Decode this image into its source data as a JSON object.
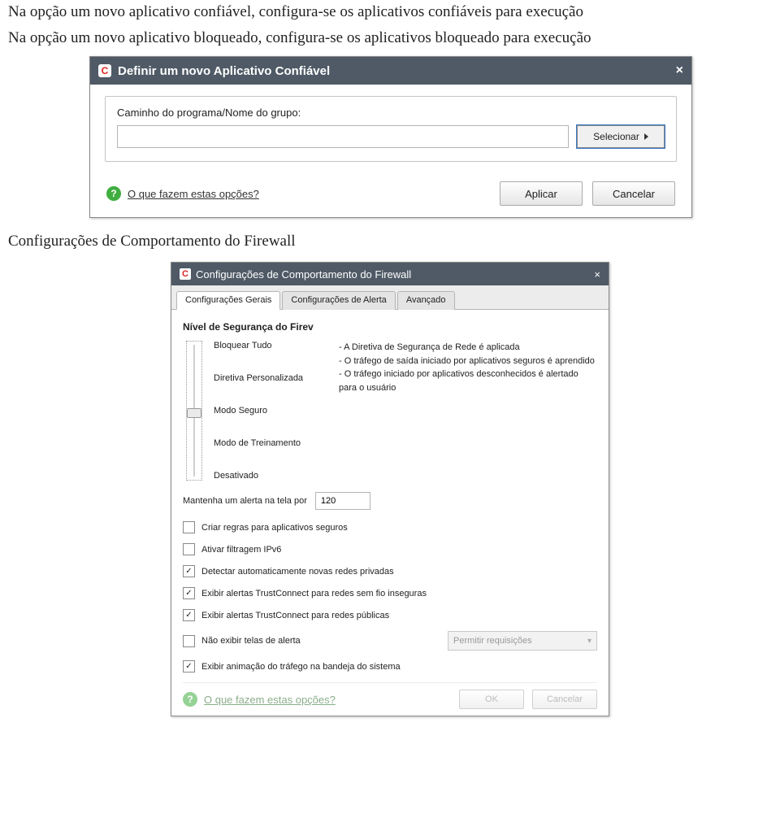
{
  "doc": {
    "line1": "Na opção um novo aplicativo confiável, configura-se os aplicativos confiáveis para execução",
    "line2": "Na opção um novo aplicativo bloqueado, configura-se os aplicativos bloqueado para execução",
    "section2": "Configurações de Comportamento do Firewall"
  },
  "dialog1": {
    "logo_letter": "C",
    "title": "Definir um novo Aplicativo Confiável",
    "close": "×",
    "field_label": "Caminho do programa/Nome do grupo:",
    "input_value": "",
    "select_label": "Selecionar",
    "help_q": "?",
    "help_text": "O que fazem estas opções?",
    "apply": "Aplicar",
    "cancel": "Cancelar"
  },
  "dialog2": {
    "logo_letter": "C",
    "title": "Configurações de Comportamento do Firewall",
    "close": "×",
    "tabs": {
      "t0": "Configurações Gerais",
      "t1": "Configurações de Alerta",
      "t2": "Avançado"
    },
    "section_title": "Nível de Segurança do Firev",
    "slider_labels": {
      "l0": "Bloquear Tudo",
      "l1": "Diretiva Personalizada",
      "l2": "Modo Seguro",
      "l3": "Modo de Treinamento",
      "l4": "Desativado"
    },
    "slider_desc_lines": {
      "d0": "- A Diretiva de Segurança de Rede é aplicada",
      "d1": "- O tráfego de saída iniciado por aplicativos seguros é aprendido",
      "d2": "- O tráfego iniciado por aplicativos desconhecidos é alertado para o usuário"
    },
    "keep_alert_label": "Mantenha um alerta na tela por",
    "keep_alert_value": "120",
    "checks": {
      "c0": "Criar regras para aplicativos seguros",
      "c1": "Ativar filtragem IPv6",
      "c2": "Detectar automaticamente novas redes privadas",
      "c3": "Exibir alertas TrustConnect para redes sem fio inseguras",
      "c4": "Exibir alertas TrustConnect para redes públicas",
      "c5": "Não exibir telas de alerta",
      "c6": "Exibir animação do tráfego na bandeja do sistema"
    },
    "dropdown_label": "Permitir requisições",
    "help_text": "O que fazem estas opções?",
    "ok": "OK",
    "cancel": "Cancelar"
  }
}
